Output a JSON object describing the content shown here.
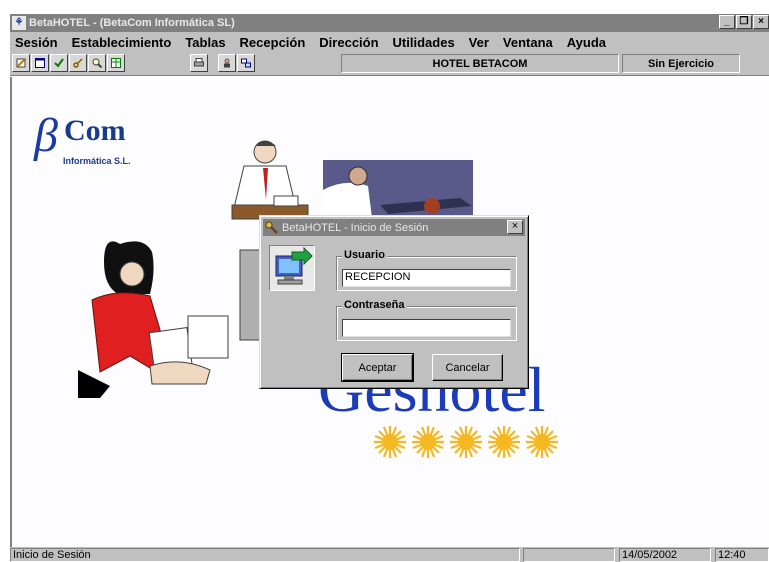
{
  "window": {
    "title": "BetaHOTEL - (BetaCom Informática SL)",
    "minimize_glyph": "_",
    "restore_glyph": "❐",
    "close_glyph": "×"
  },
  "menu": [
    "Sesión",
    "Establecimiento",
    "Tablas",
    "Recepción",
    "Dirección",
    "Utilidades",
    "Ver",
    "Ventana",
    "Ayuda"
  ],
  "toolbar": {
    "icons": [
      "edit-icon",
      "window-icon",
      "check-icon",
      "key-icon",
      "find-icon",
      "spreadsheet-icon",
      "printer-icon",
      "users-icon",
      "exchange-icon"
    ],
    "hotel_name": "HOTEL BETACOM",
    "exercise": "Sin Ejercicio"
  },
  "background": {
    "logo_symbol": "β",
    "logo_text": "Com",
    "logo_subtitle": "Informática S.L.",
    "product_text": "Geshotel",
    "stars": 5
  },
  "dialog": {
    "title": "BetaHOTEL - Inicio de Sesión",
    "close_glyph": "×",
    "usuario_label": "Usuario",
    "usuario_value": "RECEPCION",
    "password_label": "Contraseña",
    "password_value": "",
    "accept_label": "Aceptar",
    "cancel_label": "Cancelar"
  },
  "status": {
    "message": "Inicio de Sesión",
    "date": "14/05/2002",
    "time": "12:40"
  },
  "colors": {
    "chrome": "#c0c0c0",
    "titlebar": "#808080",
    "brand_blue": "#1b3bb8",
    "star": "#f5b820"
  }
}
